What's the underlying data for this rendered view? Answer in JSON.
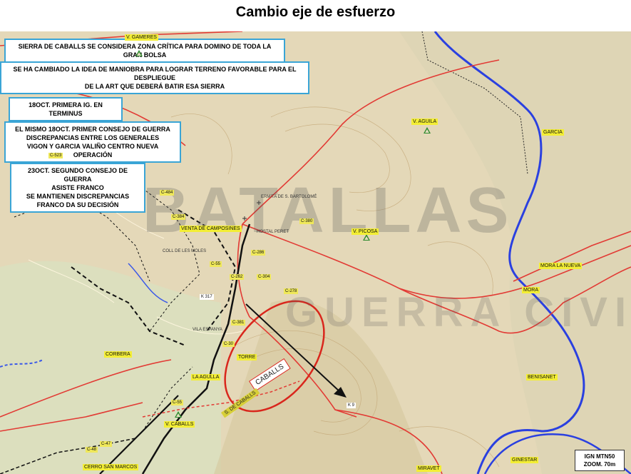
{
  "title": "Cambio eje de esfuerzo",
  "callouts": {
    "c1": "SIERRA DE CABALLS SE CONSIDERA ZONA CRÍTICA PARA DOMINO DE TODA LA GRAN BOLSA",
    "c2_line1": "SE HA CAMBIADO LA IDEA DE MANIOBRA PARA LOGRAR TERRENO FAVORABLE PARA EL DESPLIEGUE",
    "c2_line2": "DE LA ART QUE DEBERÁ BATIR ESA SIERRA",
    "c3": "18OCT. PRIMERA IG. EN TERMINUS",
    "c4_line1": "EL MISMO 18OCT. PRIMER  CONSEJO DE GUERRA",
    "c4_line2": "DISCREPANCIAS ENTRE LOS GENERALES",
    "c4_line3": "VIGON Y GARCIA VALIÑO CENTRO NUEVA OPERACIÓN",
    "c5_line1": "23OCT. SEGUNDO  CONSEJO DE GUERRA",
    "c5_line2": "ASISTE FRANCO",
    "c5_line3": "SE MANTIENEN DISCREPANCIAS",
    "c5_line4": "FRANCO DA SU DECISIÓN"
  },
  "map_labels": {
    "v_gameres": "V. GAMERES",
    "v_aguila": "V. AGUILA",
    "garcia": "GARCIA",
    "c523": "C-523",
    "c484": "C-484",
    "c384": "C-384",
    "venta": "VENTA DE CAMPOSINES",
    "c380": "C-380",
    "v_picosa": "V. PICOSA",
    "c286": "C-286",
    "c262": "C-262",
    "c304": "C-304",
    "c278": "C-278",
    "k317": "K 317",
    "c55_top": "C-55",
    "c381": "C-381",
    "c30": "C-30",
    "torre": "TORRE",
    "corbera": "CORBERA",
    "la_agulla": "LA AGULLA",
    "c55": "C-55",
    "v_caballs": "V. CABALLS",
    "c47": "C-47",
    "c48": "C-48",
    "cerro": "CERRO SAN MARCOS",
    "k9": "K 9",
    "miravet": "MIRAVET",
    "ginestar": "GINESTAR",
    "benisanet": "BENISANET",
    "mora_nueva": "MORA LA NUEVA",
    "mora": "MORA",
    "ermita": "ERMITA DE S. BARTOLOMÉ",
    "hostal": "HOSTAL PERET",
    "vilalba": "COLL DE LES MOLES",
    "villa_espanya": "VILA ESPANYA"
  },
  "caballs_tag": "CABALLS",
  "sierra_tag": "S. DE CABALLS",
  "watermark_line1": "BATALLAS",
  "watermark_line2": "GUERRA CIVIL",
  "ign": {
    "line1": "IGN MTN50",
    "line2": "ZOOM. 70m"
  },
  "colors": {
    "callout_border": "#3aa5d6",
    "river": "#2a40e0",
    "road": "#e23a34",
    "front_line": "#111111",
    "ellipse": "#d9261c",
    "label_bg": "#f3ee35",
    "peak": "#2d8a2d"
  }
}
